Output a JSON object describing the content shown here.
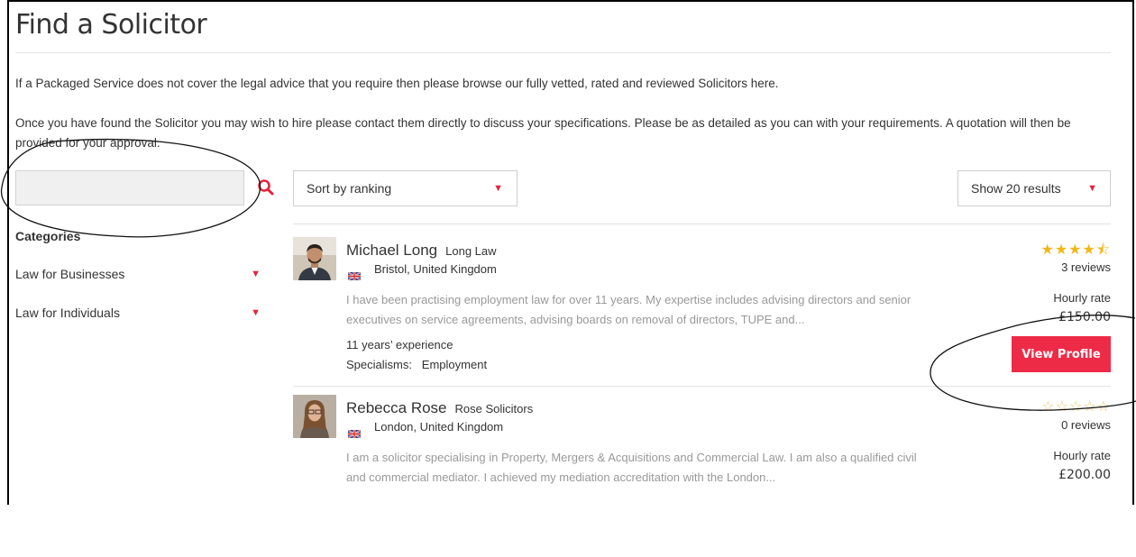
{
  "page": {
    "title": "Find a Solicitor",
    "intro_1": "If a Packaged Service does not cover the legal advice that you require then please browse our fully vetted, rated and reviewed Solicitors here.",
    "intro_2": "Once you have found the Solicitor you may wish to hire please contact them directly to discuss your specifications. Please be as detailed as you can with your requirements. A quotation will then be provided for your approval."
  },
  "sidebar": {
    "search_value": "",
    "categories_heading": "Categories",
    "categories": [
      {
        "label": "Law for Businesses",
        "arrow": "▼"
      },
      {
        "label": "Law for Individuals",
        "arrow": "▼"
      }
    ]
  },
  "controls": {
    "sort_label": "Sort by ranking",
    "show_label": "Show 20 results",
    "arrow": "▼"
  },
  "solicitors": [
    {
      "name": "Michael Long",
      "firm": "Long Law",
      "location": "Bristol, United Kingdom",
      "bio": "I have been practising employment law for over 11 years. My expertise includes advising directors and senior executives on service agreements, advising boards on removal of directors, TUPE and...",
      "experience": "11 years’ experience",
      "specialisms": "Specialisms:   Employment",
      "stars": "★★★★⯪",
      "rating": 4.5,
      "reviews": "3 reviews",
      "rate_label": "Hourly rate",
      "rate": "£150.00",
      "button": "View Profile"
    },
    {
      "name": "Rebecca Rose",
      "firm": "Rose Solicitors",
      "location": "London, United Kingdom",
      "bio": "I am a solicitor specialising in Property, Mergers & Acquisitions and Commercial Law. I am also a qualified civil and commercial mediator. I achieved my mediation accreditation with the London...",
      "stars": "☆☆☆☆☆",
      "rating": 0,
      "reviews": "0 reviews",
      "rate_label": "Hourly rate",
      "rate": "£200.00"
    }
  ],
  "colors": {
    "accent": "#ee2b47",
    "star": "#f0b719",
    "star_empty": "#e9c36a"
  }
}
